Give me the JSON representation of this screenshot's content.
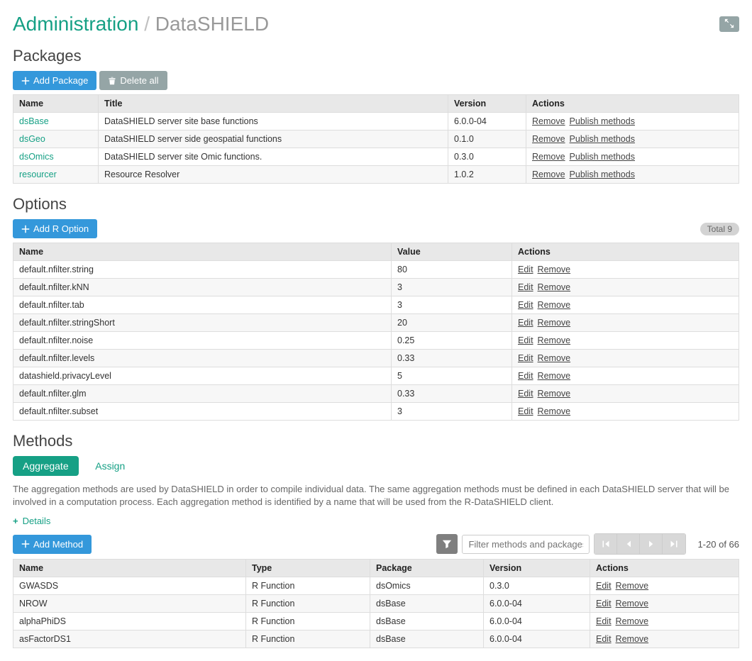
{
  "header": {
    "breadcrumb_root": "Administration",
    "breadcrumb_sep": "/",
    "breadcrumb_page": "DataSHIELD"
  },
  "packages": {
    "title": "Packages",
    "add_label": "Add Package",
    "delete_all_label": "Delete all",
    "columns": {
      "name": "Name",
      "title": "Title",
      "version": "Version",
      "actions": "Actions"
    },
    "action_labels": {
      "remove": "Remove",
      "publish": "Publish methods"
    },
    "rows": [
      {
        "name": "dsBase",
        "title": "DataSHIELD server site base functions",
        "version": "6.0.0-04"
      },
      {
        "name": "dsGeo",
        "title": "DataSHIELD server side geospatial functions",
        "version": "0.1.0"
      },
      {
        "name": "dsOmics",
        "title": "DataSHIELD server site Omic functions.",
        "version": "0.3.0"
      },
      {
        "name": "resourcer",
        "title": "Resource Resolver",
        "version": "1.0.2"
      }
    ]
  },
  "options": {
    "title": "Options",
    "add_label": "Add R Option",
    "total_label": "Total 9",
    "columns": {
      "name": "Name",
      "value": "Value",
      "actions": "Actions"
    },
    "action_labels": {
      "edit": "Edit",
      "remove": "Remove"
    },
    "rows": [
      {
        "name": "default.nfilter.string",
        "value": "80"
      },
      {
        "name": "default.nfilter.kNN",
        "value": "3"
      },
      {
        "name": "default.nfilter.tab",
        "value": "3"
      },
      {
        "name": "default.nfilter.stringShort",
        "value": "20"
      },
      {
        "name": "default.nfilter.noise",
        "value": "0.25"
      },
      {
        "name": "default.nfilter.levels",
        "value": "0.33"
      },
      {
        "name": "datashield.privacyLevel",
        "value": "5"
      },
      {
        "name": "default.nfilter.glm",
        "value": "0.33"
      },
      {
        "name": "default.nfilter.subset",
        "value": "3"
      }
    ]
  },
  "methods": {
    "title": "Methods",
    "tabs": {
      "aggregate": "Aggregate",
      "assign": "Assign"
    },
    "description": "The aggregation methods are used by DataSHIELD in order to compile individual data. The same aggregation methods must be defined in each DataSHIELD server that will be involved in a computation process. Each aggregation method is identified by a name that will be used from the R-DataSHIELD client.",
    "details_label": "Details",
    "add_label": "Add Method",
    "filter_placeholder": "Filter methods and packages...",
    "pager": "1-20 of 66",
    "columns": {
      "name": "Name",
      "type": "Type",
      "package": "Package",
      "version": "Version",
      "actions": "Actions"
    },
    "action_labels": {
      "edit": "Edit",
      "remove": "Remove"
    },
    "rows": [
      {
        "name": "GWASDS",
        "type": "R Function",
        "package": "dsOmics",
        "version": "0.3.0"
      },
      {
        "name": "NROW",
        "type": "R Function",
        "package": "dsBase",
        "version": "6.0.0-04"
      },
      {
        "name": "alphaPhiDS",
        "type": "R Function",
        "package": "dsBase",
        "version": "6.0.0-04"
      },
      {
        "name": "asFactorDS1",
        "type": "R Function",
        "package": "dsBase",
        "version": "6.0.0-04"
      }
    ]
  }
}
